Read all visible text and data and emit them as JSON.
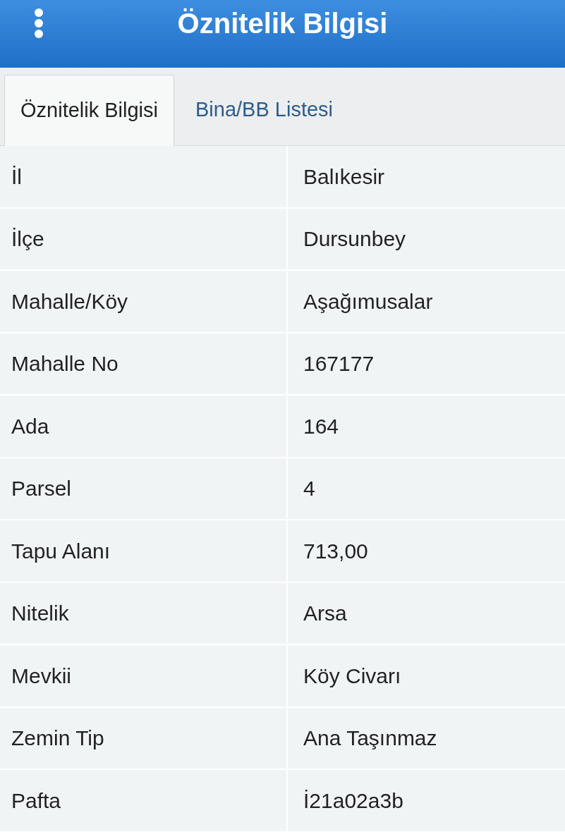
{
  "header": {
    "title": "Öznitelik Bilgisi"
  },
  "tabs": [
    {
      "label": "Öznitelik Bilgisi",
      "selected": true
    },
    {
      "label": "Bina/BB Listesi",
      "selected": false
    }
  ],
  "rows": [
    {
      "label": "İl",
      "value": "Balıkesir"
    },
    {
      "label": "İlçe",
      "value": "Dursunbey"
    },
    {
      "label": "Mahalle/Köy",
      "value": "Aşağımusalar"
    },
    {
      "label": "Mahalle No",
      "value": "167177"
    },
    {
      "label": "Ada",
      "value": "164"
    },
    {
      "label": "Parsel",
      "value": "4"
    },
    {
      "label": "Tapu Alanı",
      "value": "713,00"
    },
    {
      "label": "Nitelik",
      "value": "Arsa"
    },
    {
      "label": "Mevkii",
      "value": "Köy Civarı"
    },
    {
      "label": "Zemin Tip",
      "value": "Ana Taşınmaz"
    },
    {
      "label": "Pafta",
      "value": "İ21a02a3b"
    }
  ]
}
